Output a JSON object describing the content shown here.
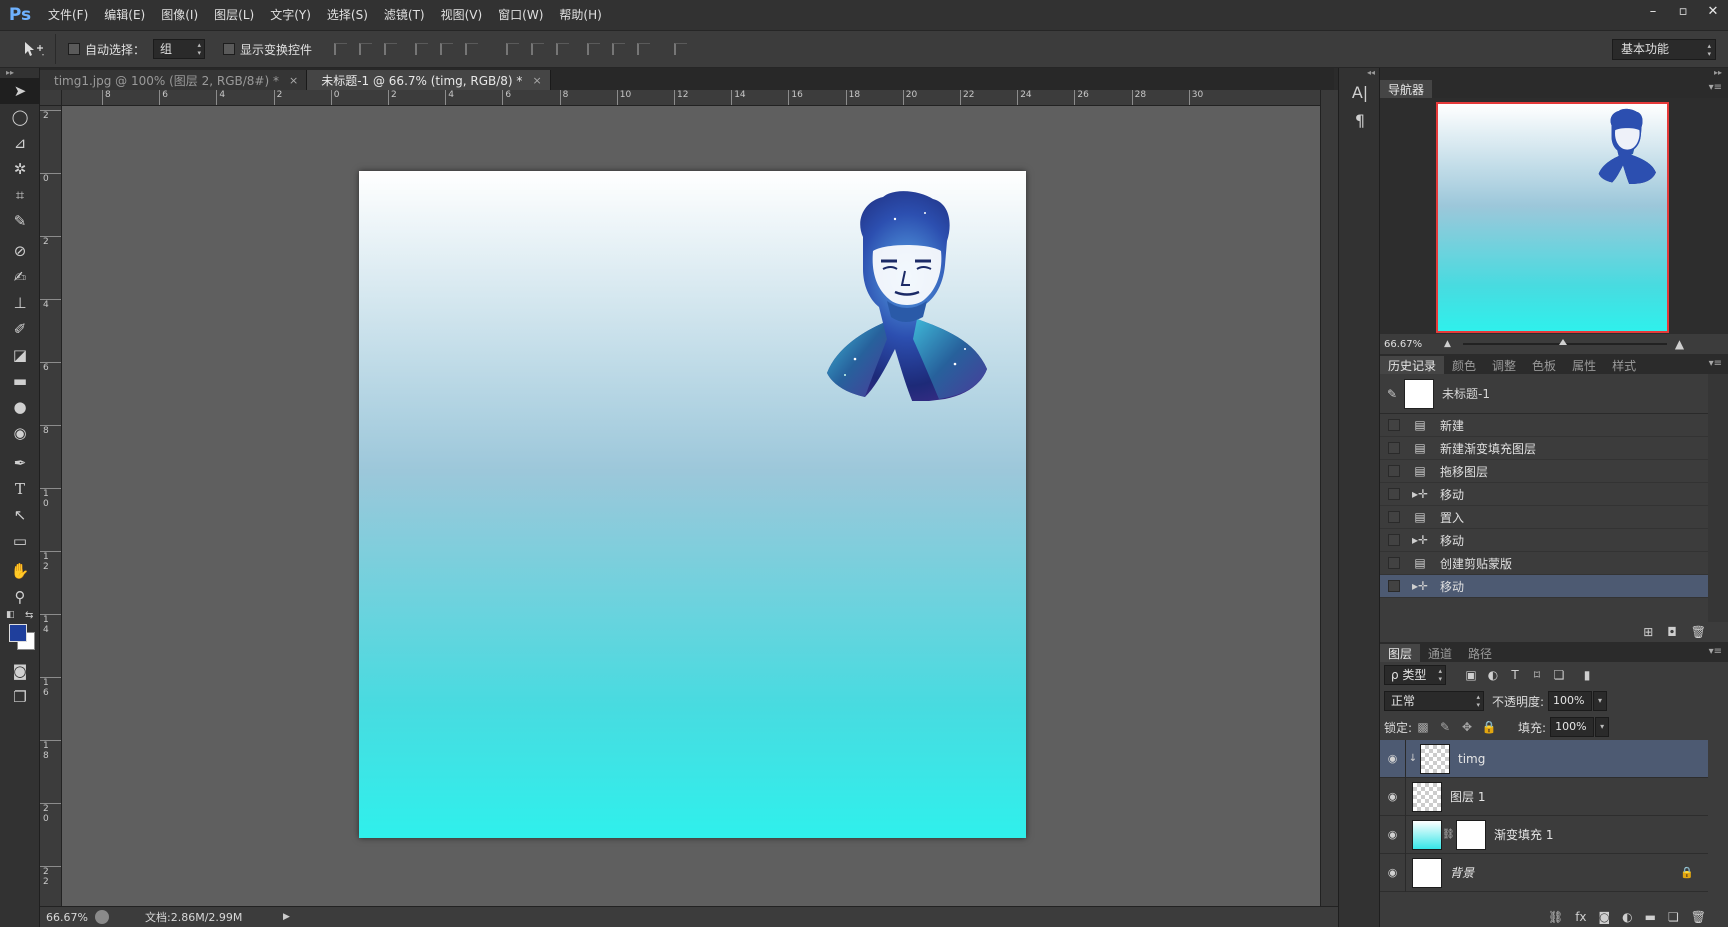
{
  "app": {
    "logo": "Ps",
    "accent": "#6fb2ff"
  },
  "menu": [
    "文件(F)",
    "编辑(E)",
    "图像(I)",
    "图层(L)",
    "文字(Y)",
    "选择(S)",
    "滤镜(T)",
    "视图(V)",
    "窗口(W)",
    "帮助(H)"
  ],
  "window_controls": {
    "minimize": "–",
    "restore": "▫",
    "close": "✕"
  },
  "options_bar": {
    "tool_icon": "move-tool-icon",
    "auto_select_label": "自动选择：",
    "auto_select_value": "组",
    "show_transform_label": "显示变换控件",
    "workspace": "基本功能"
  },
  "tabs": [
    {
      "label": "timg1.jpg @ 100% (图层 2, RGB/8#) *",
      "close": "×"
    },
    {
      "label": "未标题-1 @ 66.7% (timg, RGB/8) *",
      "close": "×"
    }
  ],
  "ruler": {
    "h_labels": [
      "8",
      "6",
      "4",
      "2",
      "0",
      "2",
      "4",
      "6",
      "8",
      "10",
      "12",
      "14",
      "16",
      "18",
      "20",
      "22",
      "24",
      "26",
      "28",
      "30"
    ],
    "v_labels": [
      "2",
      "0",
      "2",
      "4",
      "6",
      "8",
      "1\n0",
      "1\n2",
      "1\n4",
      "1\n6",
      "1\n8",
      "2\n0",
      "2\n2"
    ]
  },
  "document": {
    "gradient_top": "#ffffff",
    "gradient_bottom": "#2ff0ec"
  },
  "colors": {
    "foreground": "#1f3f9c",
    "background": "#ffffff"
  },
  "status": {
    "zoom": "66.67%",
    "doc": "文档:2.86M/2.99M",
    "arrow": "▶"
  },
  "dock_icons": [
    "character-icon",
    "paragraph-icon"
  ],
  "dock_glyphs": [
    "A|",
    "¶"
  ],
  "navigator": {
    "tab": "导航器",
    "zoom": "66.67%"
  },
  "history_panel": {
    "tabs": [
      "历史记录",
      "颜色",
      "调整",
      "色板",
      "属性",
      "样式"
    ],
    "snapshot": "未标题-1",
    "items": [
      {
        "label": "新建",
        "icon": "doc-icon"
      },
      {
        "label": "新建渐变填充图层",
        "icon": "doc-icon"
      },
      {
        "label": "拖移图层",
        "icon": "doc-icon"
      },
      {
        "label": "移动",
        "icon": "move-icon"
      },
      {
        "label": "置入",
        "icon": "doc-icon"
      },
      {
        "label": "移动",
        "icon": "move-icon"
      },
      {
        "label": "创建剪贴蒙版",
        "icon": "doc-icon"
      },
      {
        "label": "移动",
        "icon": "move-icon",
        "selected": true
      }
    ]
  },
  "layers_panel": {
    "tabs": [
      "图层",
      "通道",
      "路径"
    ],
    "filter_label": "ρ 类型",
    "blend_mode": "正常",
    "opacity_label": "不透明度:",
    "opacity": "100%",
    "lock_label": "锁定:",
    "fill_label": "填充:",
    "fill": "100%",
    "layers": [
      {
        "name": "timg",
        "selected": true,
        "clipped": true
      },
      {
        "name": "图层 1"
      },
      {
        "name": "渐变填充 1",
        "has_mask": true
      },
      {
        "name": "背景",
        "locked": true,
        "italic": true
      }
    ]
  }
}
